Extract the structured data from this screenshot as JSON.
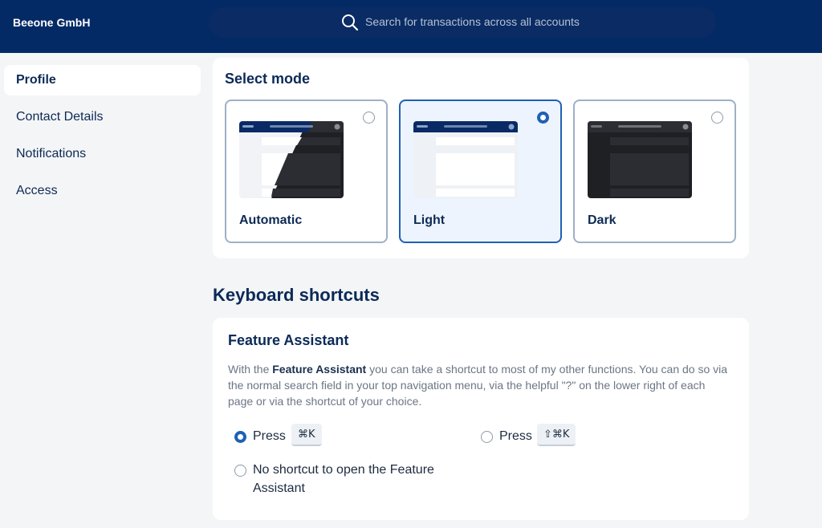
{
  "header": {
    "company": "Beeone GmbH",
    "search": {
      "placeholder": "Search for transactions across all accounts",
      "icon": "search-icon"
    }
  },
  "sidebar": {
    "items": [
      {
        "label": "Profile",
        "active": true
      },
      {
        "label": "Contact Details",
        "active": false
      },
      {
        "label": "Notifications",
        "active": false
      },
      {
        "label": "Access",
        "active": false
      }
    ]
  },
  "mode": {
    "title": "Select mode",
    "options": [
      {
        "label": "Automatic",
        "selected": false
      },
      {
        "label": "Light",
        "selected": true
      },
      {
        "label": "Dark",
        "selected": false
      }
    ]
  },
  "shortcuts": {
    "title": "Keyboard shortcuts",
    "feature_assistant": {
      "title": "Feature Assistant",
      "desc_prefix": "With the ",
      "desc_bold": "Feature Assistant",
      "desc_rest": " you can take a shortcut to most of my other functions. You can do so via the normal search field in your top navigation menu, via the helpful \"?\" on the lower right of each page or via the shortcut of your choice.",
      "options": [
        {
          "label": "Press",
          "key": "⌘K",
          "selected": true
        },
        {
          "label": "Press",
          "key": "⇧⌘K",
          "selected": false
        },
        {
          "label": "No shortcut to open the Feature",
          "label2": "Assistant",
          "selected": false
        }
      ]
    }
  },
  "colors": {
    "navy": "#042a66",
    "accent": "#1f60b5",
    "selected_bg": "#edf4fe"
  }
}
